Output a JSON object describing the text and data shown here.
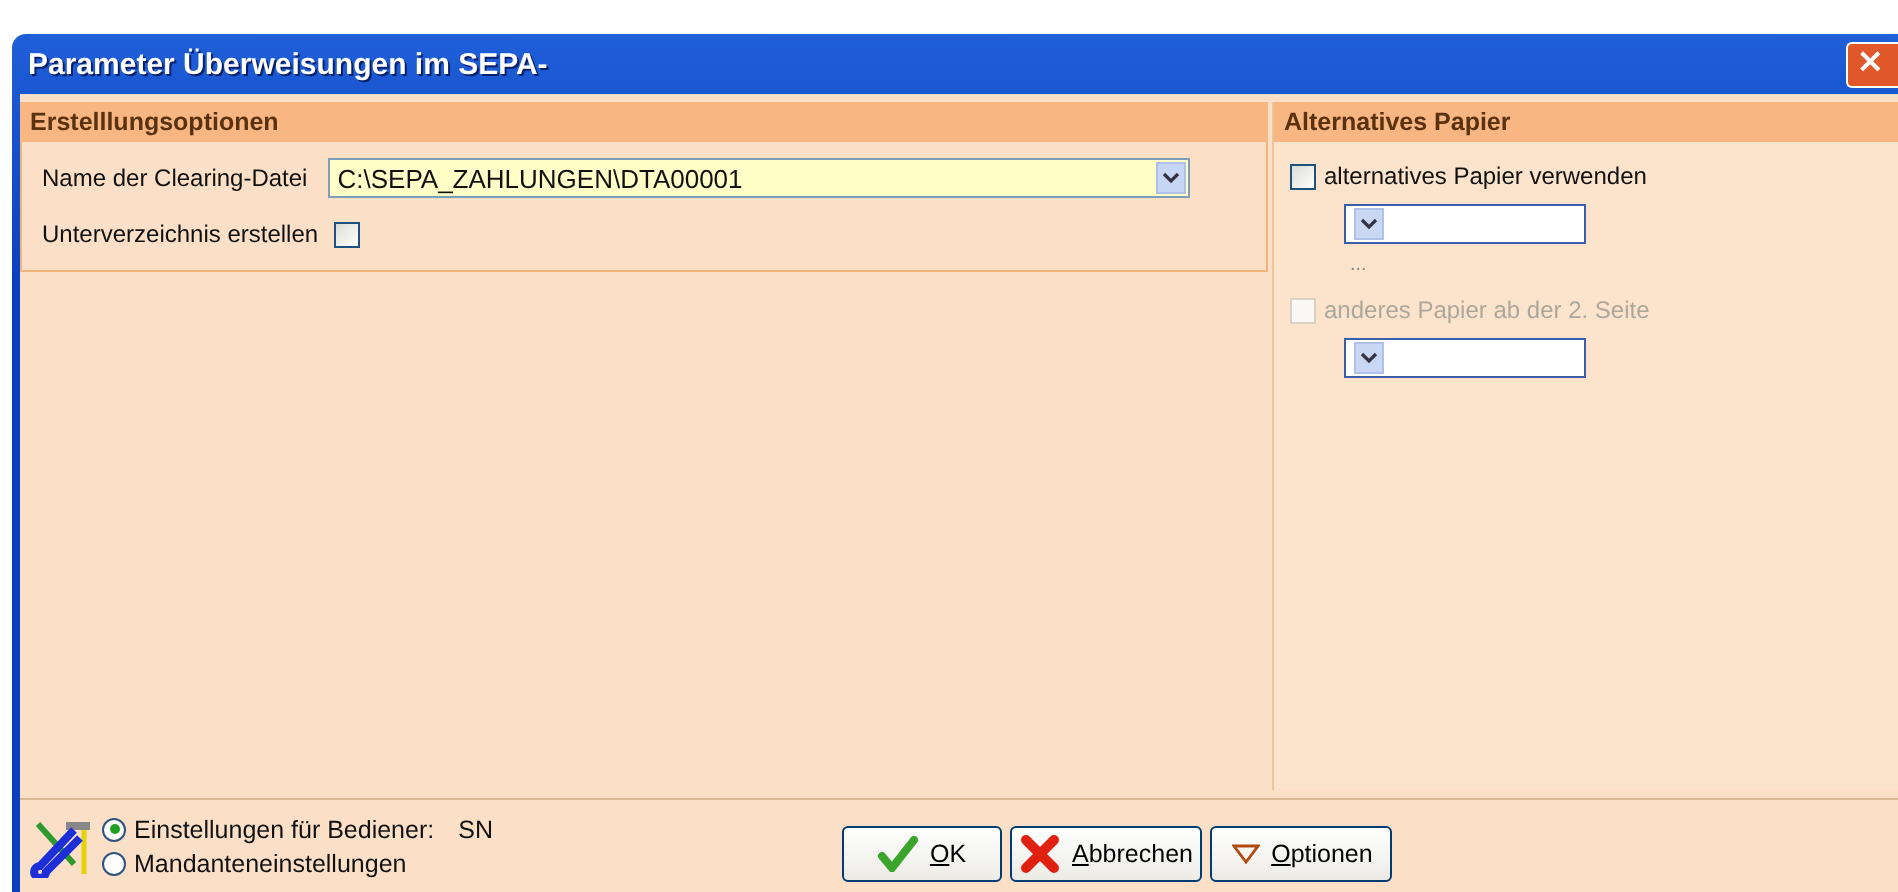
{
  "window": {
    "title": "Parameter Überweisungen im SEPA-",
    "close": "×"
  },
  "options_panel": {
    "title": "Erstelllungsoptionen",
    "clearing_file": {
      "label": "Name der Clearing-Datei",
      "value": "C:\\SEPA_ZAHLUNGEN\\DTA00001"
    },
    "subdirectory": {
      "label": "Unterverzeichnis erstellen",
      "checked": false
    }
  },
  "paper_panel": {
    "title": "Alternatives Papier",
    "items": [
      {
        "label": "alternatives Papier verwenden",
        "checked": false,
        "disabled": false
      },
      {
        "label": "anderes Papier ab der 2. Seite",
        "checked": false,
        "disabled": true
      }
    ],
    "ellipsis": "..."
  },
  "scope": [
    {
      "label": "Einstellungen für Bediener:",
      "selected": true,
      "user": "SN"
    },
    {
      "label": "Mandanteneinstellungen",
      "selected": false
    }
  ],
  "buttons": [
    {
      "kind": "ok",
      "label": "OK"
    },
    {
      "kind": "cancel",
      "label": "Abbrechen"
    },
    {
      "kind": "options",
      "label": "Optionen"
    }
  ]
}
